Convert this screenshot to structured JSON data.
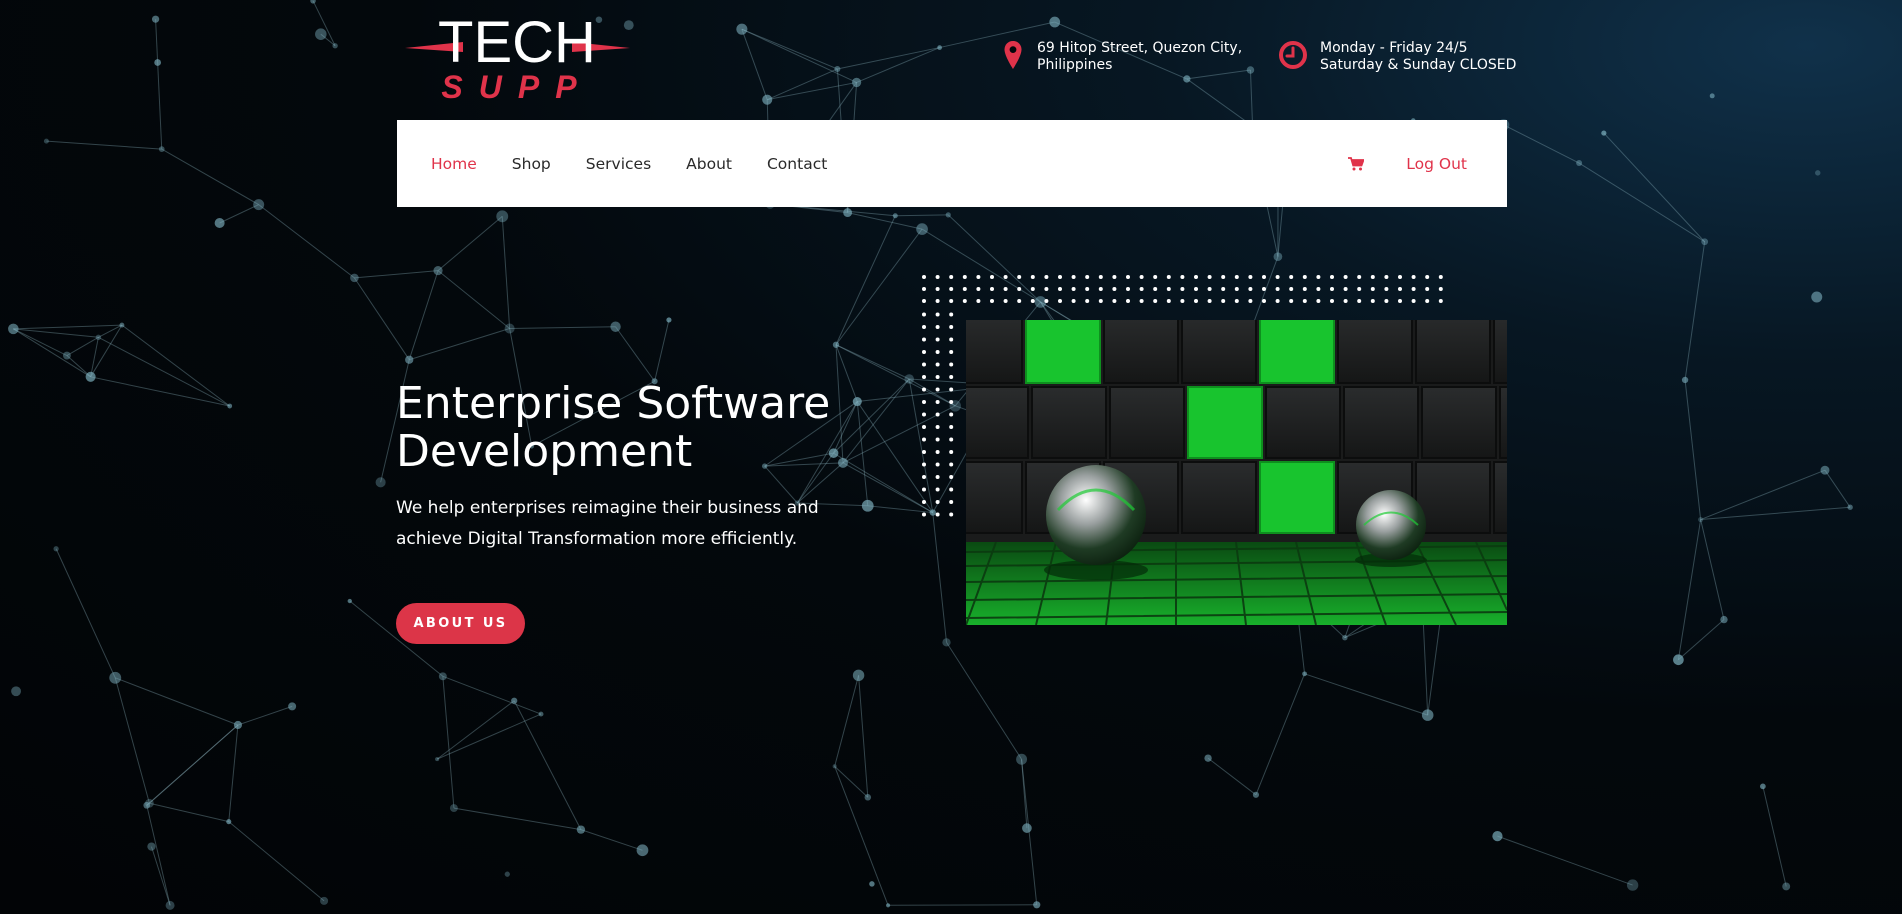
{
  "brand": {
    "top": "TECH",
    "bottom": "SUPP",
    "accent": "#e0334a"
  },
  "contact": {
    "address_icon": "map-pin-icon",
    "address_line1": "69 Hitop Street, Quezon City,",
    "address_line2": "Philippines",
    "hours_icon": "clock-icon",
    "hours_line1": "Monday - Friday 24/5",
    "hours_line2": "Saturday & Sunday CLOSED"
  },
  "nav": {
    "items": [
      {
        "label": "Home",
        "active": true
      },
      {
        "label": "Shop"
      },
      {
        "label": "Services"
      },
      {
        "label": "About"
      },
      {
        "label": "Contact"
      }
    ],
    "cart_icon": "shopping-cart-icon",
    "logout": "Log Out"
  },
  "hero": {
    "title_line1": "Enterprise Software",
    "title_line2": "Development",
    "subtitle": "We help enterprises reimagine their business and achieve Digital Transformation more efficiently.",
    "button": "ABOUT US",
    "image": "green-cubes-chrome-spheres-image"
  },
  "colors": {
    "accent": "#dc3548",
    "background": "#03070b",
    "navbar": "#ffffff"
  }
}
